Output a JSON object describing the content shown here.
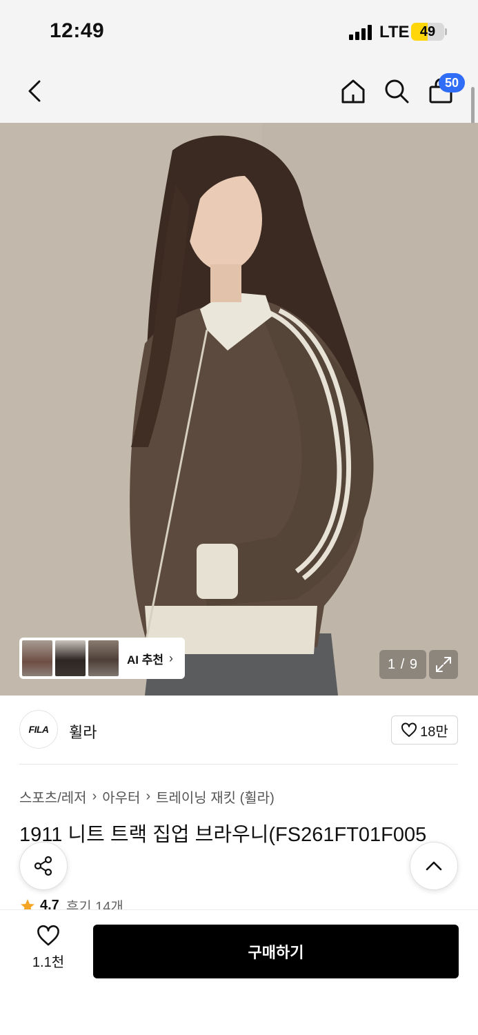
{
  "status_bar": {
    "time": "12:49",
    "network": "LTE",
    "battery": "49",
    "battery_level": 0.49
  },
  "nav": {
    "cart_count": "50"
  },
  "gallery": {
    "ai_label": "AI 추천",
    "ai_chevron": "›",
    "counter": "1 / 9"
  },
  "brand": {
    "logo_text": "FILA",
    "name": "휠라",
    "likes": "18만"
  },
  "breadcrumb": {
    "items": [
      "스포츠/레저",
      "아우터",
      "트레이닝 재킷 (휠라)"
    ]
  },
  "product": {
    "title": "1911 니트 트랙 집업 브라우니(FS261FT01F005",
    "rating": "4.7",
    "review_count": "후기 14개"
  },
  "bottom_bar": {
    "wish_count": "1.1천",
    "buy_label": "구매하기"
  },
  "colors": {
    "accent_blue": "#2f6df6",
    "battery_yellow": "#ffd60a",
    "star": "#f5a524",
    "buy_button": "#000000"
  }
}
